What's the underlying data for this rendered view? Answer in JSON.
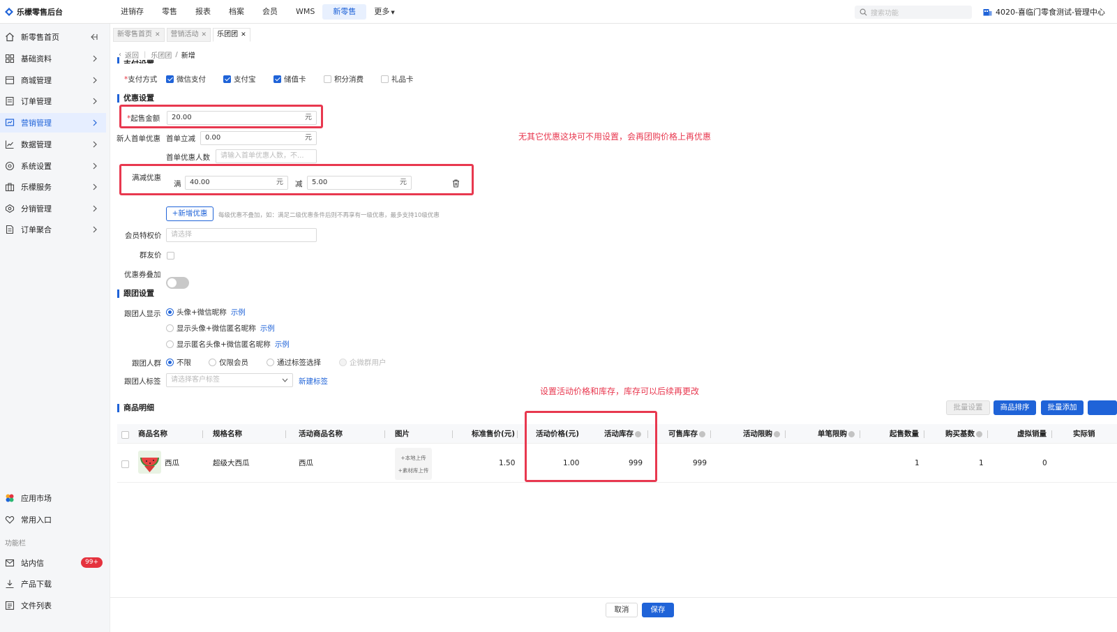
{
  "app": {
    "title": "乐檬零售后台"
  },
  "topnav": [
    {
      "label": "进销存"
    },
    {
      "label": "零售"
    },
    {
      "label": "报表"
    },
    {
      "label": "档案"
    },
    {
      "label": "会员"
    },
    {
      "label": "WMS"
    },
    {
      "label": "新零售",
      "active": true
    },
    {
      "label": "更多"
    }
  ],
  "search": {
    "placeholder": "搜索功能"
  },
  "store": {
    "name": "4020-喜临门零食测试-管理中心"
  },
  "sidebar": {
    "items": [
      {
        "label": "新零售首页"
      },
      {
        "label": "基础资料"
      },
      {
        "label": "商城管理"
      },
      {
        "label": "订单管理"
      },
      {
        "label": "营销管理",
        "active": true
      },
      {
        "label": "数据管理"
      },
      {
        "label": "系统设置"
      },
      {
        "label": "乐檬服务"
      },
      {
        "label": "分销管理"
      },
      {
        "label": "订单聚合"
      }
    ],
    "bottom": [
      {
        "label": "应用市场"
      },
      {
        "label": "常用入口"
      }
    ],
    "section_label": "功能栏",
    "tools": [
      {
        "label": "站内信",
        "badge": "99+"
      },
      {
        "label": "产品下载"
      },
      {
        "label": "文件列表"
      }
    ]
  },
  "tabs": [
    {
      "label": "新零售首页"
    },
    {
      "label": "营销活动"
    },
    {
      "label": "乐团团",
      "active": true
    }
  ],
  "breadcrumb": {
    "back": "返回",
    "parent": "乐团团",
    "current": "新增"
  },
  "payment": {
    "section_title": "支付设置",
    "label": "支付方式",
    "options": [
      {
        "label": "微信支付",
        "checked": true
      },
      {
        "label": "支付宝",
        "checked": true
      },
      {
        "label": "储值卡",
        "checked": true
      },
      {
        "label": "积分消费",
        "checked": false
      },
      {
        "label": "礼品卡",
        "checked": false
      }
    ]
  },
  "discount": {
    "section_title": "优惠设置",
    "min_amount_label": "起售金额",
    "min_amount_value": "20.00",
    "unit": "元",
    "newcomer_label": "新人首单优惠",
    "first_order_label": "首单立减",
    "first_order_value": "0.00",
    "first_count_label": "首单优惠人数",
    "first_count_placeholder": "请输入首单优惠人数，不...",
    "full_reduce_label": "满减优惠",
    "full_label": "满",
    "full_value": "40.00",
    "reduce_label": "减",
    "reduce_value": "5.00",
    "add_button": "+新增优惠",
    "add_hint": "每级优惠不叠加，如：满足二级优惠条件后则不再享有一级优惠，最多支持10级优惠",
    "member_price_label": "会员特权价",
    "member_price_placeholder": "请选择",
    "group_price_label": "群友价",
    "coupon_stack_label": "优惠券叠加"
  },
  "annotation_1": "无其它优惠这块可不用设置，会再团购价格上再优惠",
  "annotation_2": "设置活动价格和库存，库存可以后续再更改",
  "follow": {
    "section_title": "跟团设置",
    "display_label": "跟团人显示",
    "display_options": [
      {
        "label": "头像+微信昵称",
        "selected": true,
        "example": "示例"
      },
      {
        "label": "显示头像+微信匿名昵称",
        "selected": false,
        "example": "示例"
      },
      {
        "label": "显示匿名头像+微信匿名昵称",
        "selected": false,
        "example": "示例"
      }
    ],
    "crowd_label": "跟团人群",
    "crowd_options": [
      {
        "label": "不限",
        "selected": true
      },
      {
        "label": "仅限会员",
        "selected": false
      },
      {
        "label": "通过标签选择",
        "selected": false
      },
      {
        "label": "企微群用户",
        "selected": false,
        "disabled": true
      }
    ],
    "tag_label": "跟团人标签",
    "tag_placeholder": "请选择客户标签",
    "new_tag": "新建标签"
  },
  "goods": {
    "section_title": "商品明细",
    "buttons": {
      "batch_set": "批量设置",
      "sort": "商品排序",
      "batch_add": "批量添加"
    },
    "columns": [
      "商品名称",
      "规格名称",
      "活动商品名称",
      "图片",
      "标准售价(元)",
      "活动价格(元)",
      "活动库存",
      "可售库存",
      "活动限购",
      "单笔限购",
      "起售数量",
      "购买基数",
      "虚拟销量",
      "实际销"
    ],
    "rows": [
      {
        "name": "西瓜",
        "spec": "超级大西瓜",
        "activity_name": "西瓜",
        "upload_local": "+本地上传",
        "upload_lib": "+素材库上传",
        "std_price": "1.50",
        "activity_price": "1.00",
        "activity_stock": "999",
        "sellable_stock": "999",
        "activity_limit": "",
        "single_limit": "",
        "min_qty": "1",
        "buy_base": "1",
        "virtual_sales": "0"
      }
    ]
  },
  "footer": {
    "cancel": "取消",
    "save": "保存"
  },
  "colors": {
    "primary": "#1f63d8",
    "highlight": "#e8384f",
    "badge": "#e5323e"
  }
}
